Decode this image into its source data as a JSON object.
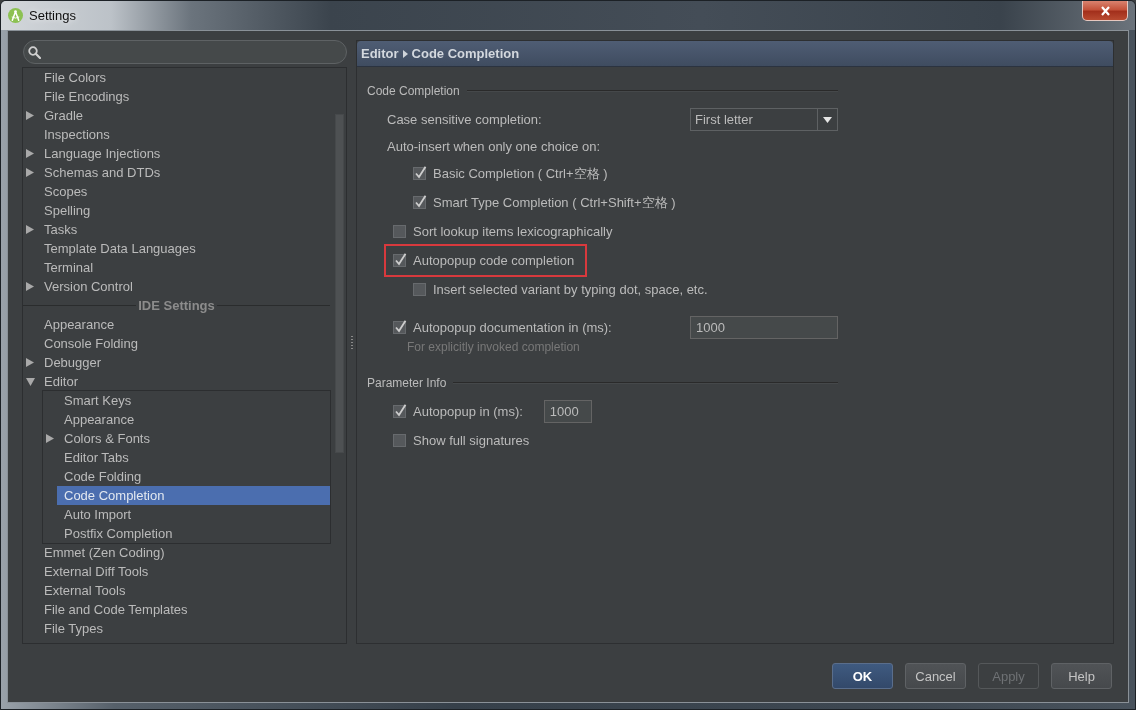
{
  "window": {
    "title": "Settings"
  },
  "sidebar": {
    "items": [
      {
        "kind": "item",
        "label": "File Colors",
        "selected": false
      },
      {
        "kind": "item",
        "label": "File Encodings",
        "selected": false
      },
      {
        "kind": "item",
        "label": "Gradle",
        "expanded": false,
        "selected": false
      },
      {
        "kind": "item",
        "label": "Inspections",
        "selected": false
      },
      {
        "kind": "item",
        "label": "Language Injections",
        "expanded": false,
        "selected": false
      },
      {
        "kind": "item",
        "label": "Schemas and DTDs",
        "expanded": false,
        "selected": false
      },
      {
        "kind": "item",
        "label": "Scopes",
        "selected": false
      },
      {
        "kind": "item",
        "label": "Spelling",
        "selected": false
      },
      {
        "kind": "item",
        "label": "Tasks",
        "expanded": false,
        "selected": false
      },
      {
        "kind": "item",
        "label": "Template Data Languages",
        "selected": false
      },
      {
        "kind": "item",
        "label": "Terminal",
        "selected": false
      },
      {
        "kind": "item",
        "label": "Version Control",
        "expanded": false,
        "selected": false
      },
      {
        "kind": "separator",
        "label": "IDE Settings"
      },
      {
        "kind": "item",
        "label": "Appearance",
        "selected": false
      },
      {
        "kind": "item",
        "label": "Console Folding",
        "selected": false
      },
      {
        "kind": "item",
        "label": "Debugger",
        "expanded": false,
        "selected": false
      },
      {
        "kind": "item",
        "label": "Editor",
        "expanded": true,
        "selected": false,
        "children": [
          {
            "kind": "item",
            "label": "Smart Keys",
            "selected": false
          },
          {
            "kind": "item",
            "label": "Appearance",
            "selected": false
          },
          {
            "kind": "item",
            "label": "Colors & Fonts",
            "expanded": false,
            "selected": false
          },
          {
            "kind": "item",
            "label": "Editor Tabs",
            "selected": false
          },
          {
            "kind": "item",
            "label": "Code Folding",
            "selected": false
          },
          {
            "kind": "item",
            "label": "Code Completion",
            "selected": true
          },
          {
            "kind": "item",
            "label": "Auto Import",
            "selected": false
          },
          {
            "kind": "item",
            "label": "Postfix Completion",
            "selected": false
          }
        ]
      },
      {
        "kind": "item",
        "label": "Emmet (Zen Coding)",
        "selected": false
      },
      {
        "kind": "item",
        "label": "External Diff Tools",
        "selected": false
      },
      {
        "kind": "item",
        "label": "External Tools",
        "selected": false
      },
      {
        "kind": "item",
        "label": "File and Code Templates",
        "selected": false
      },
      {
        "kind": "item",
        "label": "File Types",
        "selected": false
      }
    ]
  },
  "panel": {
    "breadcrumb": [
      "Editor",
      "Code Completion"
    ],
    "groups": [
      {
        "title": "Code Completion",
        "rows": [
          {
            "kind": "combo",
            "label": "Case sensitive completion:",
            "value": "First letter"
          },
          {
            "kind": "label",
            "label": "Auto-insert when only one choice on:",
            "children": [
              {
                "kind": "checkbox",
                "label": "Basic Completion ( Ctrl+空格 )",
                "checked": true,
                "highlighted": false
              },
              {
                "kind": "checkbox",
                "label": "Smart Type Completion ( Ctrl+Shift+空格 )",
                "checked": true,
                "highlighted": false
              }
            ]
          },
          {
            "kind": "checkbox",
            "label": "Sort lookup items lexicographically",
            "checked": false,
            "highlighted": false
          },
          {
            "kind": "checkbox",
            "label": "Autopopup code completion",
            "checked": true,
            "highlighted": true,
            "children": [
              {
                "kind": "checkbox",
                "label": "Insert selected variant by typing dot, space, etc.",
                "checked": false,
                "highlighted": false
              }
            ]
          },
          {
            "kind": "checkbox_field",
            "label": "Autopopup documentation in (ms):",
            "checked": true,
            "highlighted": false,
            "value": "1000",
            "hint": "For explicitly invoked completion"
          }
        ]
      },
      {
        "title": "Parameter Info",
        "rows": [
          {
            "kind": "checkbox_field",
            "label": "Autopopup in (ms):",
            "checked": true,
            "highlighted": false,
            "value": "1000"
          },
          {
            "kind": "checkbox",
            "label": "Show full signatures",
            "checked": false,
            "highlighted": false
          }
        ]
      }
    ]
  },
  "buttons": [
    {
      "label": "OK",
      "kind": "default",
      "disabled": false
    },
    {
      "label": "Cancel",
      "kind": "normal",
      "disabled": false
    },
    {
      "label": "Apply",
      "kind": "normal",
      "disabled": true
    },
    {
      "label": "Help",
      "kind": "normal",
      "disabled": false
    }
  ]
}
